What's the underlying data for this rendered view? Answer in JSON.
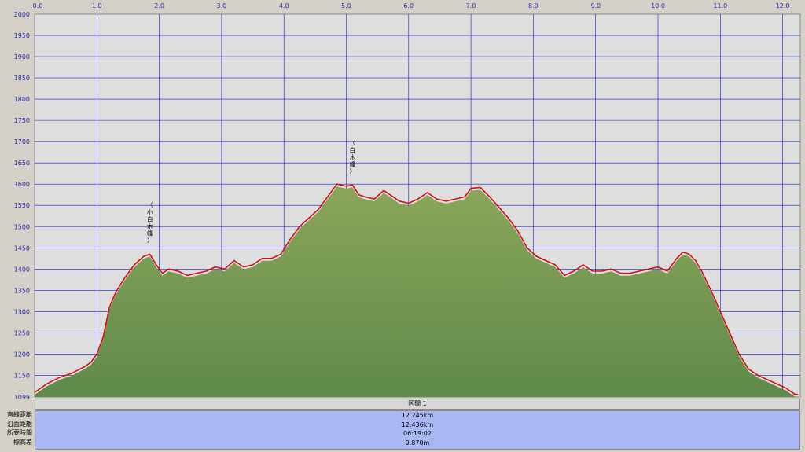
{
  "chart_data": {
    "type": "area",
    "x_ticks": [
      "0.0",
      "1.0",
      "2.0",
      "3.0",
      "4.0",
      "5.0",
      "6.0",
      "7.0",
      "8.0",
      "9.0",
      "10.0",
      "11.0",
      "12.0",
      "0"
    ],
    "y_ticks": [
      "2000",
      "1950",
      "1900",
      "1850",
      "1800",
      "1750",
      "1700",
      "1650",
      "1600",
      "1550",
      "1500",
      "1450",
      "1400",
      "1350",
      "1300",
      "1250",
      "1200",
      "1150",
      "1099"
    ],
    "xlim": [
      0,
      12.245
    ],
    "ylim": [
      1099,
      2000
    ],
    "grid": true,
    "annotations": [
      {
        "text": "〈小白木峰〉",
        "x": 1.85
      },
      {
        "text": "〈白木峰〉",
        "x": 5.1
      }
    ],
    "series": [
      {
        "color": "#d01010",
        "x": [
          0.0,
          0.1,
          0.2,
          0.4,
          0.6,
          0.8,
          0.9,
          1.0,
          1.1,
          1.2,
          1.3,
          1.45,
          1.6,
          1.75,
          1.85,
          1.95,
          2.05,
          2.15,
          2.3,
          2.45,
          2.6,
          2.75,
          2.9,
          3.05,
          3.2,
          3.35,
          3.5,
          3.65,
          3.8,
          3.95,
          4.1,
          4.25,
          4.4,
          4.55,
          4.7,
          4.85,
          5.0,
          5.1,
          5.2,
          5.3,
          5.45,
          5.6,
          5.75,
          5.85,
          6.0,
          6.15,
          6.3,
          6.45,
          6.6,
          6.75,
          6.9,
          7.0,
          7.15,
          7.3,
          7.45,
          7.6,
          7.75,
          7.9,
          8.05,
          8.2,
          8.35,
          8.5,
          8.65,
          8.8,
          8.95,
          9.1,
          9.25,
          9.4,
          9.55,
          9.7,
          9.85,
          10.0,
          10.15,
          10.3,
          10.4,
          10.5,
          10.6,
          10.7,
          10.85,
          11.0,
          11.15,
          11.3,
          11.45,
          11.6,
          11.75,
          11.9,
          12.05,
          12.2,
          12.245
        ],
        "y": [
          1110,
          1120,
          1130,
          1145,
          1155,
          1170,
          1180,
          1200,
          1240,
          1310,
          1345,
          1380,
          1410,
          1430,
          1435,
          1410,
          1390,
          1400,
          1395,
          1385,
          1390,
          1395,
          1405,
          1400,
          1420,
          1405,
          1410,
          1425,
          1425,
          1435,
          1470,
          1500,
          1520,
          1540,
          1570,
          1600,
          1595,
          1598,
          1575,
          1570,
          1565,
          1585,
          1570,
          1560,
          1555,
          1565,
          1580,
          1565,
          1560,
          1565,
          1570,
          1590,
          1592,
          1570,
          1545,
          1520,
          1490,
          1450,
          1430,
          1420,
          1410,
          1385,
          1395,
          1410,
          1395,
          1395,
          1400,
          1390,
          1390,
          1395,
          1400,
          1405,
          1395,
          1425,
          1440,
          1435,
          1420,
          1395,
          1350,
          1300,
          1250,
          1200,
          1165,
          1150,
          1140,
          1130,
          1120,
          1105,
          1105
        ]
      }
    ]
  },
  "section": {
    "label": "区間 1"
  },
  "stats": [
    {
      "label": "直線距離",
      "value": "12.245km"
    },
    {
      "label": "沿面距離",
      "value": "12.436km"
    },
    {
      "label": "所要時間",
      "value": "06:19:02"
    },
    {
      "label": "標高差",
      "value": "0.870m"
    }
  ],
  "colors": {
    "fill_top": "#8aa65a",
    "fill_bottom": "#5e8848",
    "line": "#d01010",
    "grid": "#1a1ad0",
    "plot_bg": "#dedede",
    "stats_bg": "#a9b8f4"
  }
}
